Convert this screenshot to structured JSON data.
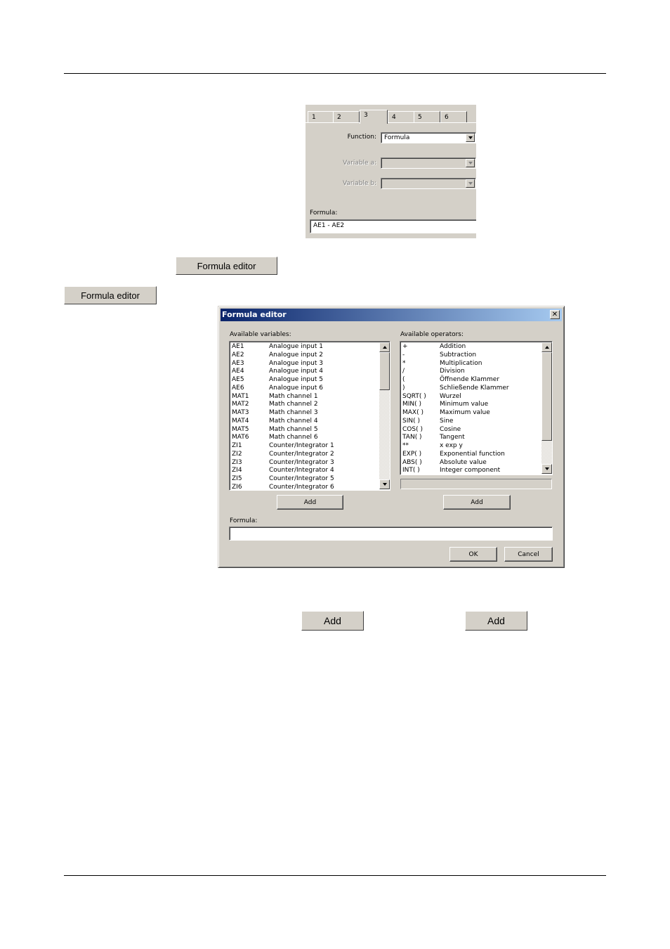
{
  "panel": {
    "tabs": [
      "1",
      "2",
      "3",
      "4",
      "5",
      "6"
    ],
    "active_tab": "3",
    "function_label": "Function:",
    "function_value": "Formula",
    "variable_a_label": "Variable a:",
    "variable_b_label": "Variable b:",
    "formula_label": "Formula:",
    "formula_value": "AE1 - AE2"
  },
  "buttons": {
    "formula_editor_1": "Formula editor",
    "formula_editor_2": "Formula editor",
    "add_1": "Add",
    "add_2": "Add"
  },
  "dialog": {
    "title": "Formula editor",
    "close_glyph": "✕",
    "variables_label": "Available variables:",
    "operators_label": "Available operators:",
    "variables": [
      [
        "AE1",
        "Analogue input 1"
      ],
      [
        "AE2",
        "Analogue input 2"
      ],
      [
        "AE3",
        "Analogue input 3"
      ],
      [
        "AE4",
        "Analogue input 4"
      ],
      [
        "AE5",
        "Analogue input 5"
      ],
      [
        "AE6",
        "Analogue input 6"
      ],
      [
        "MAT1",
        "Math channel 1"
      ],
      [
        "MAT2",
        "Math channel 2"
      ],
      [
        "MAT3",
        "Math channel 3"
      ],
      [
        "MAT4",
        "Math channel 4"
      ],
      [
        "MAT5",
        "Math channel 5"
      ],
      [
        "MAT6",
        "Math channel 6"
      ],
      [
        "ZI1",
        "Counter/Integrator 1"
      ],
      [
        "ZI2",
        "Counter/Integrator 2"
      ],
      [
        "ZI3",
        "Counter/Integrator 3"
      ],
      [
        "ZI4",
        "Counter/Integrator 4"
      ],
      [
        "ZI5",
        "Counter/Integrator 5"
      ],
      [
        "ZI6",
        "Counter/Integrator 6"
      ]
    ],
    "operators": [
      [
        "+",
        "Addition"
      ],
      [
        "-",
        "Subtraction"
      ],
      [
        "*",
        "Multiplication"
      ],
      [
        "/",
        "Division"
      ],
      [
        "(",
        "Öffnende Klammer"
      ],
      [
        ")",
        "Schließende Klammer"
      ],
      [
        "SQRT( )",
        "Wurzel"
      ],
      [
        "MIN( )",
        "Minimum value"
      ],
      [
        "MAX( )",
        "Maximum value"
      ],
      [
        "SIN( )",
        "Sine"
      ],
      [
        "COS( )",
        "Cosine"
      ],
      [
        "TAN( )",
        "Tangent"
      ],
      [
        "**",
        "x exp y"
      ],
      [
        "EXP( )",
        "Exponential function"
      ],
      [
        "ABS( )",
        "Absolute value"
      ],
      [
        "INT( )",
        "Integer component"
      ]
    ],
    "add_variable_label": "Add",
    "add_operator_label": "Add",
    "formula_label": "Formula:",
    "formula_value": "",
    "ok_label": "OK",
    "cancel_label": "Cancel"
  }
}
